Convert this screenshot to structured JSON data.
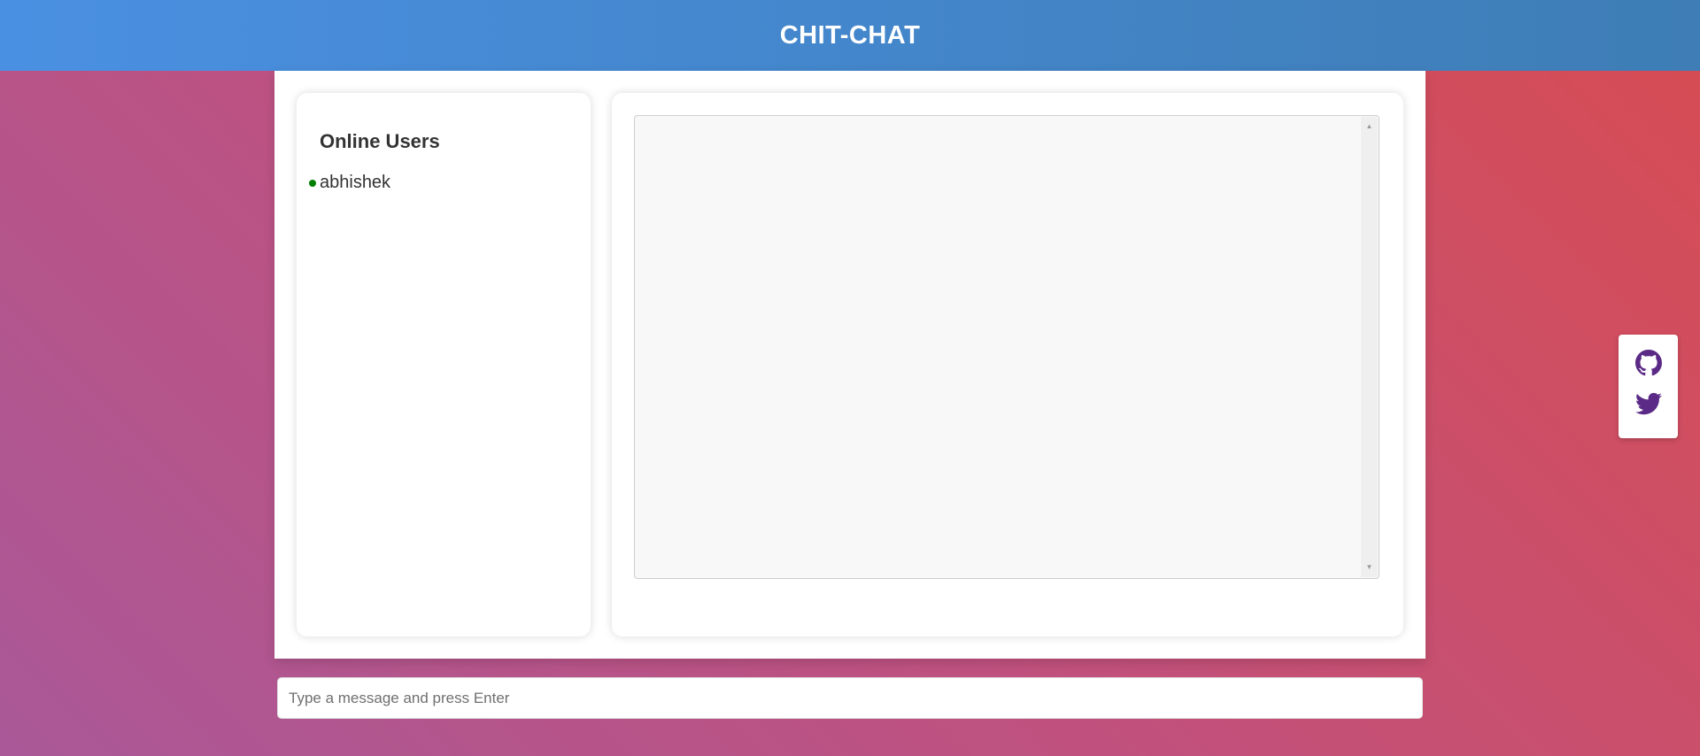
{
  "header": {
    "title": "CHIT-CHAT"
  },
  "sidebar": {
    "heading": "Online Users",
    "users": [
      {
        "name": "abhishek",
        "status": "online"
      }
    ]
  },
  "chat": {
    "messages": [],
    "input_placeholder": "Type a message and press Enter"
  },
  "social": {
    "items": [
      {
        "icon": "github-icon"
      },
      {
        "icon": "twitter-icon"
      }
    ]
  },
  "colors": {
    "header_gradient_start": "#4a90e2",
    "header_gradient_end": "#3e7db5",
    "background_gradient_start": "#aa5898",
    "background_gradient_end": "#d74c52",
    "online_status": "#008000",
    "social_icon": "#5b2a86"
  }
}
